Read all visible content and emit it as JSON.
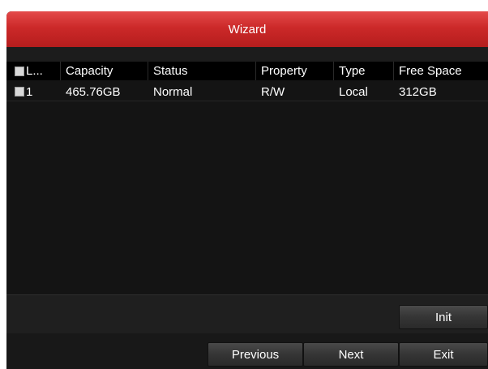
{
  "window": {
    "title": "Wizard"
  },
  "table": {
    "columns": [
      "L...",
      "Capacity",
      "Status",
      "Property",
      "Type",
      "Free Space"
    ],
    "rows": [
      {
        "label": "1",
        "capacity": "465.76GB",
        "status": "Normal",
        "property": "R/W",
        "type": "Local",
        "free_space": "312GB"
      }
    ]
  },
  "buttons": {
    "init": "Init",
    "previous": "Previous",
    "next": "Next",
    "exit": "Exit"
  },
  "colors": {
    "title_bar": "#cc2929",
    "panel": "#141414",
    "header": "#000000"
  }
}
